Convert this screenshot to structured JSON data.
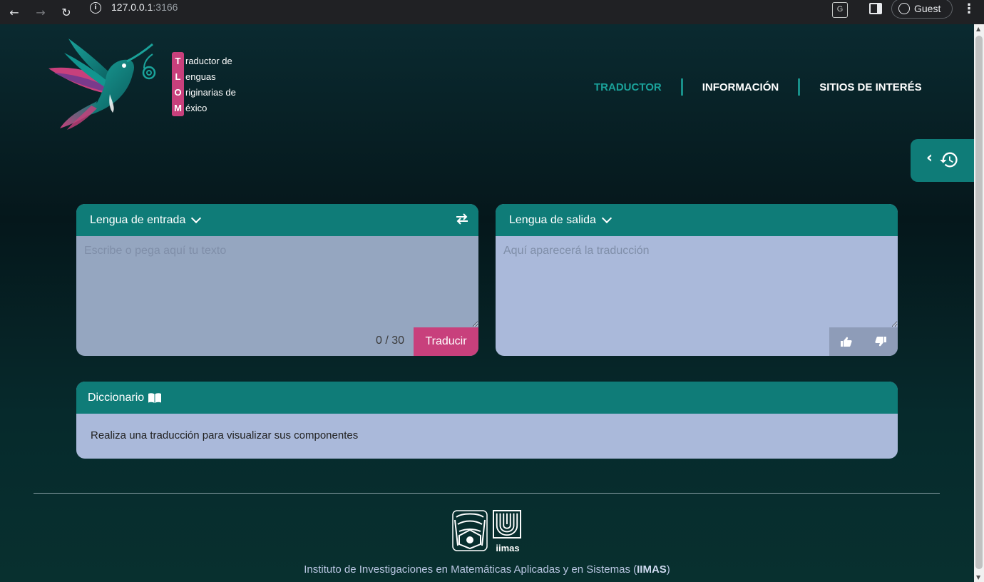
{
  "browser": {
    "url_host": "127.0.0.1",
    "url_port": ":3166",
    "profile_label": "Guest"
  },
  "brand": {
    "lines": [
      {
        "initial": "T",
        "rest": "raductor de"
      },
      {
        "initial": "L",
        "rest": "enguas"
      },
      {
        "initial": "O",
        "rest": "riginarias de"
      },
      {
        "initial": "M",
        "rest": "éxico"
      }
    ]
  },
  "nav": {
    "items": [
      "TRADUCTOR",
      "INFORMACIÓN",
      "SITIOS DE INTERÉS"
    ],
    "active": "TRADUCTOR"
  },
  "input_card": {
    "title": "Lengua de entrada",
    "placeholder": "Escribe o pega aquí tu texto",
    "counter": "0 / 30",
    "button": "Traducir"
  },
  "output_card": {
    "title": "Lengua de salida",
    "placeholder": "Aquí aparecerá la traducción"
  },
  "dictionary": {
    "title": "Diccionario",
    "message": "Realiza una traducción para visualizar sus componentes"
  },
  "footer": {
    "iimas_logo_text": "iimas",
    "institute_prefix": "Instituto de Investigaciones en Matemáticas Aplicadas y en Sistemas (",
    "institute_abbr": "IIMAS",
    "institute_suffix": ")"
  },
  "colors": {
    "teal": "#0f7c78",
    "pink": "#c8407c",
    "card_bg": "#aab9da"
  }
}
